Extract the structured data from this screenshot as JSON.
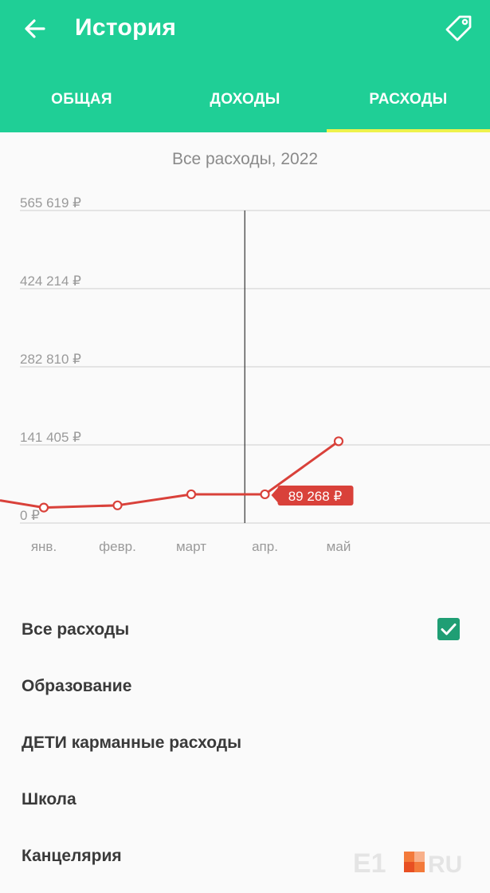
{
  "header": {
    "title": "История",
    "tabs": [
      {
        "label": "ОБЩАЯ",
        "active": false
      },
      {
        "label": "ДОХОДЫ",
        "active": false
      },
      {
        "label": "РАСХОДЫ",
        "active": true
      }
    ],
    "icons": {
      "back": "arrow-left-icon",
      "tag": "tag-icon"
    }
  },
  "chart_title": "Все расходы, 2022",
  "chart_data": {
    "type": "line",
    "title": "Все расходы, 2022",
    "categories": [
      "янв.",
      "февр.",
      "март",
      "апр.",
      "май"
    ],
    "series": [
      {
        "values": [
          28000,
          32000,
          52000,
          52000,
          148000
        ]
      }
    ],
    "y_ticks": [
      "0 ₽",
      "141 405 ₽",
      "282 810 ₽",
      "424 214 ₽",
      "565 619 ₽"
    ],
    "ylim": [
      0,
      565619
    ],
    "grid": true,
    "tooltip": {
      "label": "89 268 ₽",
      "category": "апр."
    },
    "series_color": "#d9413a"
  },
  "list": {
    "items": [
      {
        "label": "Все расходы",
        "checked": true
      },
      {
        "label": "Образование",
        "checked": false
      },
      {
        "label": "ДЕТИ карманные расходы",
        "checked": false
      },
      {
        "label": "Школа",
        "checked": false
      },
      {
        "label": "Канцелярия",
        "checked": false
      }
    ]
  },
  "watermark": {
    "brand": "E1",
    "suffix": "RU"
  },
  "colors": {
    "primary": "#1fcf96",
    "tab_indicator": "#eef24c",
    "checkbox": "#1f9e74",
    "line": "#d9413a"
  }
}
